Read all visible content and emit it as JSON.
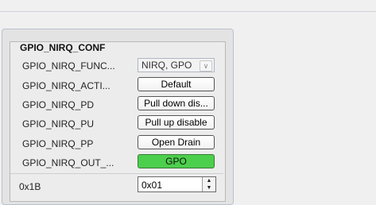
{
  "panel": {
    "title": "GPIO_NIRQ_CONF",
    "rows": [
      {
        "label": "GPIO_NIRQ_FUNC...",
        "control": "select",
        "value": "NIRQ, GPO"
      },
      {
        "label": "GPIO_NIRQ_ACTI...",
        "control": "button",
        "value": "Default"
      },
      {
        "label": "GPIO_NIRQ_PD",
        "control": "button",
        "value": "Pull down dis..."
      },
      {
        "label": "GPIO_NIRQ_PU",
        "control": "button",
        "value": "Pull up disable"
      },
      {
        "label": "GPIO_NIRQ_PP",
        "control": "button",
        "value": "Open Drain"
      },
      {
        "label": "GPIO_NIRQ_OUT_...",
        "control": "button",
        "value": "GPO",
        "color": "#4ccf4c"
      }
    ],
    "address": {
      "label": "0x1B",
      "value": "0x01"
    }
  },
  "icons": {
    "dropdown": "chevron-down-icon",
    "spin_up": "arrow-up-icon",
    "spin_down": "arrow-down-icon"
  }
}
